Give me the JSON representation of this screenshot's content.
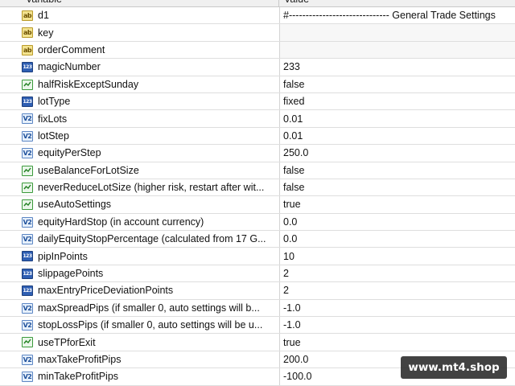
{
  "header": {
    "variable": "Variable",
    "value": "Value"
  },
  "rows": [
    {
      "icon": "ab",
      "name": "d1",
      "value": "#------------------------------ General Trade Settings"
    },
    {
      "icon": "ab",
      "name": "key",
      "value": ""
    },
    {
      "icon": "ab",
      "name": "orderComment",
      "value": ""
    },
    {
      "icon": "123",
      "name": "magicNumber",
      "value": "233"
    },
    {
      "icon": "bool",
      "name": "halfRiskExceptSunday",
      "value": "false"
    },
    {
      "icon": "123",
      "name": "lotType",
      "value": "fixed"
    },
    {
      "icon": "v2",
      "name": "fixLots",
      "value": "0.01"
    },
    {
      "icon": "v2",
      "name": "lotStep",
      "value": "0.01"
    },
    {
      "icon": "v2",
      "name": "equityPerStep",
      "value": "250.0"
    },
    {
      "icon": "bool",
      "name": "useBalanceForLotSize",
      "value": "false"
    },
    {
      "icon": "bool",
      "name": "neverReduceLotSize (higher risk, restart after wit...",
      "value": "false"
    },
    {
      "icon": "bool",
      "name": "useAutoSettings",
      "value": "true"
    },
    {
      "icon": "v2",
      "name": "equityHardStop (in account currency)",
      "value": "0.0"
    },
    {
      "icon": "v2",
      "name": "dailyEquityStopPercentage (calculated from 17 G...",
      "value": "0.0"
    },
    {
      "icon": "123",
      "name": "pipInPoints",
      "value": "10"
    },
    {
      "icon": "123",
      "name": "slippagePoints",
      "value": "2"
    },
    {
      "icon": "123",
      "name": "maxEntryPriceDeviationPoints",
      "value": "2"
    },
    {
      "icon": "v2",
      "name": "maxSpreadPips (if smaller 0, auto settings will b...",
      "value": "-1.0"
    },
    {
      "icon": "v2",
      "name": "stopLossPips (if smaller 0, auto settings will be u...",
      "value": "-1.0"
    },
    {
      "icon": "bool",
      "name": "useTPforExit",
      "value": "true"
    },
    {
      "icon": "v2",
      "name": "maxTakeProfitPips",
      "value": "200.0"
    },
    {
      "icon": "v2",
      "name": "minTakeProfitPips",
      "value": "-100.0"
    }
  ],
  "icon_kinds": {
    "ab": {
      "name": "string-type-icon",
      "glyph": "ab"
    },
    "123": {
      "name": "integer-type-icon",
      "glyph": "123"
    },
    "v2": {
      "name": "double-type-icon",
      "glyph": "V2"
    },
    "bool": {
      "name": "boolean-type-icon",
      "glyph": ""
    }
  },
  "watermark": "www.mt4.shop"
}
